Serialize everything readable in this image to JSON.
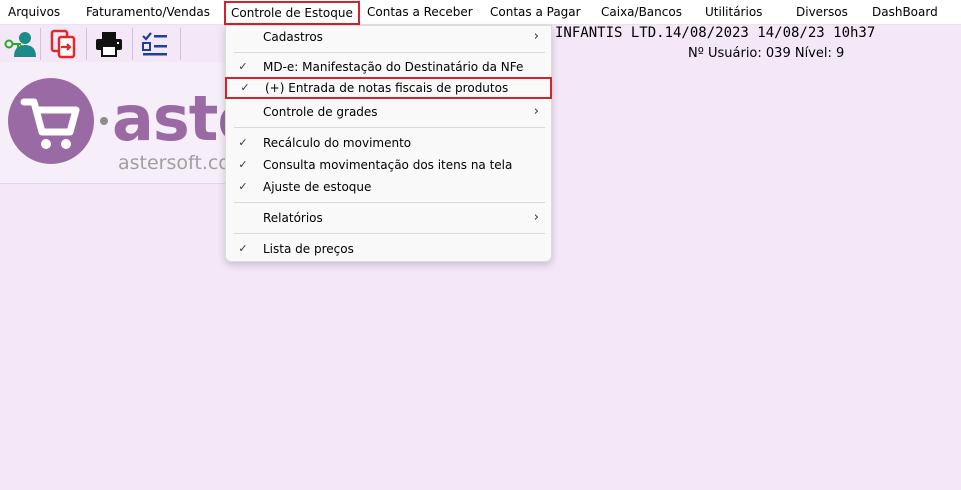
{
  "menubar": {
    "items": [
      {
        "label": "Arquivos"
      },
      {
        "label": "Faturamento/Vendas"
      },
      {
        "label": "Controle de Estoque"
      },
      {
        "label": "Contas a Receber"
      },
      {
        "label": "Contas a Pagar"
      },
      {
        "label": "Caixa/Bancos"
      },
      {
        "label": "Utilitários"
      },
      {
        "label": "Diversos"
      },
      {
        "label": "DashBoard"
      }
    ]
  },
  "toolbar": {
    "icons": [
      "user-key-icon",
      "document-exchange-icon",
      "printer-icon",
      "checklist-icon"
    ]
  },
  "logo": {
    "word": "aster",
    "url": "astersoft.com"
  },
  "status": {
    "line1": "INFANTIS LTD.14/08/2023  14/08/23 10h37",
    "user": "Nº Usuário: 039  Nível: 9"
  },
  "dropdown": {
    "items": [
      {
        "label": "Cadastros",
        "check": "",
        "arrow": "›"
      },
      {
        "label": "MD-e: Manifestação do Destinatário da NFe",
        "check": "✓",
        "arrow": ""
      },
      {
        "label": "(+) Entrada de notas fiscais de produtos",
        "check": "✓",
        "arrow": ""
      },
      {
        "label": "Controle de grades",
        "check": "",
        "arrow": "›"
      },
      {
        "label": "Recálculo do movimento",
        "check": "✓",
        "arrow": ""
      },
      {
        "label": "Consulta movimentação dos itens na tela",
        "check": "✓",
        "arrow": ""
      },
      {
        "label": "Ajuste de estoque",
        "check": "✓",
        "arrow": ""
      },
      {
        "label": "Relatórios",
        "check": "",
        "arrow": "›"
      },
      {
        "label": "Lista de preços",
        "check": "✓",
        "arrow": ""
      }
    ]
  },
  "colors": {
    "background": "#f4e8f8",
    "highlight_border": "#d5222b",
    "brand_purple": "#9a6aa4",
    "icon_teal": "#1a8a8a",
    "icon_red": "#e02a2a",
    "icon_blue": "#1f3f9f"
  }
}
